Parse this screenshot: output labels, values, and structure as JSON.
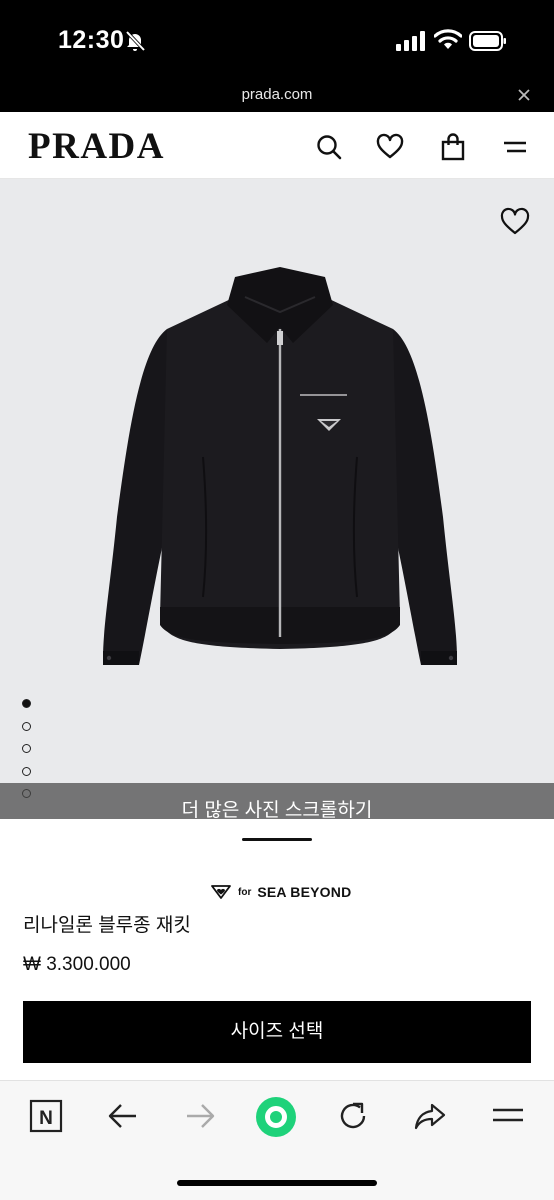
{
  "status_bar": {
    "time": "12:30"
  },
  "browser": {
    "url": "prada.com"
  },
  "header": {
    "logo": "PRADA",
    "icons": [
      "search-icon",
      "heart-icon",
      "bag-icon",
      "menu-icon"
    ]
  },
  "gallery": {
    "total_images": 5,
    "active_index": 0,
    "scroll_hint": "더 많은 사진 스크롤하기"
  },
  "product": {
    "badge_for": "for",
    "badge_label": "SEA BEYOND",
    "name": "리나일론 블루종 재킷",
    "price": "₩ 3.300.000",
    "size_button": "사이즈 선택"
  },
  "toolbar": {
    "n_label": "N",
    "icons": [
      "n-icon",
      "back-arrow-icon",
      "forward-arrow-icon",
      "home-icon",
      "reload-icon",
      "share-icon",
      "menu-icon"
    ]
  },
  "colors": {
    "accent_green": "#1ed27a",
    "background_image": "#e9eaec",
    "button_black": "#000000"
  }
}
